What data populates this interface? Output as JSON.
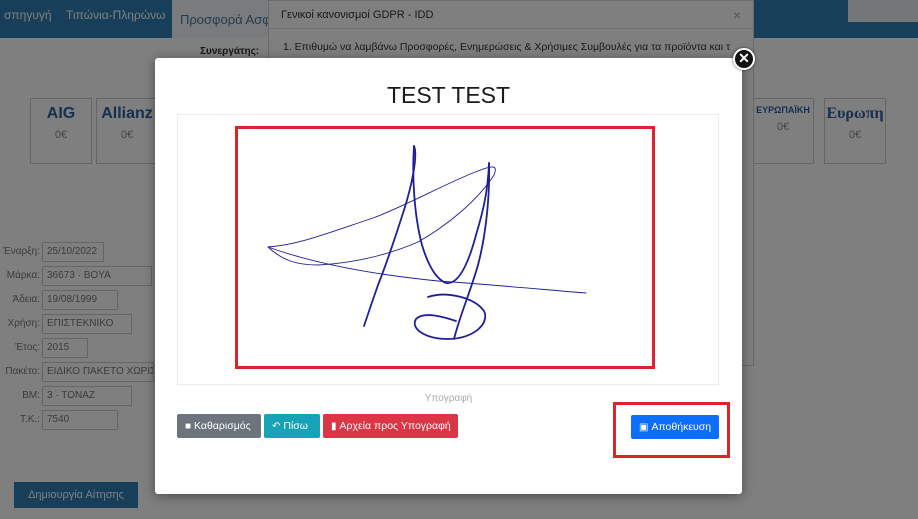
{
  "background": {
    "nav": [
      "σπηγυγή",
      "Τιπώνια-Πληρώνω"
    ],
    "tab_label": "Προσφορά Ασφ",
    "partner_label": "Συνεργάτης:",
    "insurers": [
      {
        "logo": "AIG",
        "price": "0€"
      },
      {
        "logo": "Allianz",
        "price": "0€"
      },
      {
        "logo": "ΕΥΡΩΠΑΪΚΗ",
        "price": "0€"
      },
      {
        "logo": "Ευρωπη",
        "price": "0€"
      }
    ],
    "form_rows": [
      {
        "label": "Έναρξη:",
        "value": "25/10/2022"
      },
      {
        "label": "Μάρκα:",
        "value": "36673 · BOYA"
      },
      {
        "label": "Άδεια:",
        "value": "19/08/1999"
      },
      {
        "label": "Χρήση:",
        "value": "ΕΠΙΣΤΕΚΝΙΚΟ"
      },
      {
        "label": "Έτος:",
        "value": "2015"
      },
      {
        "label": "Πακέτο:",
        "value": "ΕΙΔΙΚΟ ΠΑΚΕΤΟ ΧΩΡΙΣ"
      },
      {
        "label": "ΒΜ:",
        "value": "3 · ΤΟΝΑΖ"
      },
      {
        "label": "Τ.Κ.:",
        "value": "7540"
      }
    ],
    "create_button": "Δημιουργία Αίτησης"
  },
  "gdpr_modal": {
    "title": "Γενικοί κανονισμοί GDPR - IDD",
    "close": "×",
    "body_line": "1. Επιθυμώ να λαμβάνω Προσφορές, Ενημερώσεις & Χρήσιμες Συμβουλές για τα προϊόντα και τ"
  },
  "signature_modal": {
    "title": "TEST TEST",
    "close_icon": "close-icon",
    "caption": "Υπογραφή",
    "buttons": {
      "clear": "Καθαρισμός",
      "back": "Πίσω",
      "files": "Αρχεία προς Υπογραφή",
      "save": "Αποθήκευση"
    },
    "highlight_color": "#d9252b",
    "ink_color": "#1f1f9a"
  }
}
